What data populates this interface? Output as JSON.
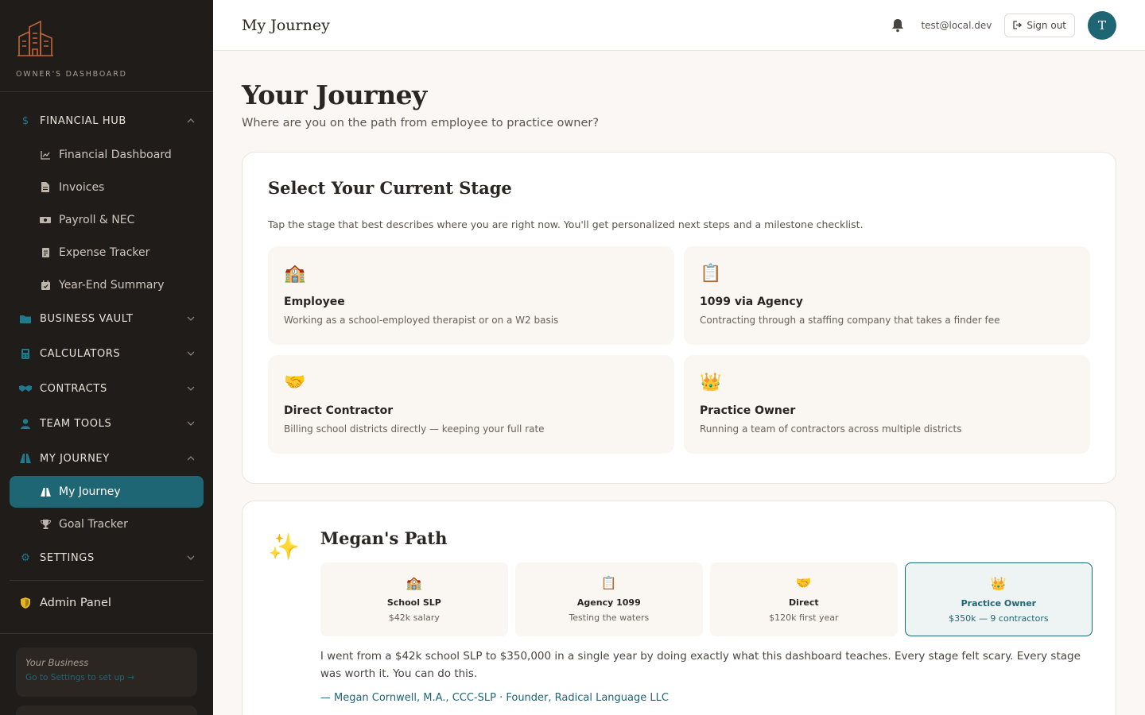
{
  "sidebar": {
    "brand_label": "OWNER'S DASHBOARD",
    "sections": [
      {
        "label": "FINANCIAL HUB",
        "icon": "dollar-icon",
        "expanded": true,
        "items": [
          {
            "label": "Financial Dashboard",
            "icon": "chart-line-icon"
          },
          {
            "label": "Invoices",
            "icon": "file-icon"
          },
          {
            "label": "Payroll & NEC",
            "icon": "money-icon"
          },
          {
            "label": "Expense Tracker",
            "icon": "receipt-icon"
          },
          {
            "label": "Year-End Summary",
            "icon": "calendar-icon"
          }
        ]
      },
      {
        "label": "BUSINESS VAULT",
        "icon": "folder-icon",
        "expanded": false
      },
      {
        "label": "CALCULATORS",
        "icon": "calculator-icon",
        "expanded": false
      },
      {
        "label": "CONTRACTS",
        "icon": "handshake-icon",
        "expanded": false
      },
      {
        "label": "TEAM TOOLS",
        "icon": "user-icon",
        "expanded": false
      },
      {
        "label": "MY JOURNEY",
        "icon": "road-icon",
        "expanded": true,
        "items": [
          {
            "label": "My Journey",
            "icon": "road-icon",
            "active": true
          },
          {
            "label": "Goal Tracker",
            "icon": "trophy-icon"
          }
        ]
      },
      {
        "label": "SETTINGS",
        "icon": "gear-icon",
        "expanded": false
      }
    ],
    "admin_label": "Admin Panel",
    "business": {
      "title": "Your Business",
      "link": "Go to Settings to set up →"
    }
  },
  "header": {
    "title": "My Journey",
    "email": "test@local.dev",
    "signout_label": "Sign out",
    "avatar_initial": "T"
  },
  "main": {
    "title": "Your Journey",
    "subtitle": "Where are you on the path from employee to practice owner?",
    "stage_card": {
      "title": "Select Your Current Stage",
      "description": "Tap the stage that best describes where you are right now. You'll get personalized next steps and a milestone checklist.",
      "stages": [
        {
          "emoji": "🏫",
          "name": "Employee",
          "desc": "Working as a school-employed therapist or on a W2 basis"
        },
        {
          "emoji": "📋",
          "name": "1099 via Agency",
          "desc": "Contracting through a staffing company that takes a finder fee"
        },
        {
          "emoji": "🤝",
          "name": "Direct Contractor",
          "desc": "Billing school districts directly — keeping your full rate"
        },
        {
          "emoji": "👑",
          "name": "Practice Owner",
          "desc": "Running a team of contractors across multiple districts"
        }
      ]
    },
    "path_card": {
      "emoji": "✨",
      "title": "Megan's Path",
      "steps": [
        {
          "emoji": "🏫",
          "name": "School SLP",
          "sub": "$42k salary"
        },
        {
          "emoji": "📋",
          "name": "Agency 1099",
          "sub": "Testing the waters"
        },
        {
          "emoji": "🤝",
          "name": "Direct",
          "sub": "$120k first year"
        },
        {
          "emoji": "👑",
          "name": "Practice Owner",
          "sub": "$350k — 9 contractors",
          "active": true
        }
      ],
      "quote": "I went from a $42k school SLP to $350,000 in a single year by doing exactly what this dashboard teaches. Every stage felt scary. Every stage was worth it. You can do this.",
      "attribution": "— Megan Cornwell, M.A., CCC-SLP · Founder, Radical Language LLC"
    }
  },
  "colors": {
    "sidebar_bg": "#201c19",
    "accent": "#1f6675",
    "brand": "#c0673a"
  }
}
